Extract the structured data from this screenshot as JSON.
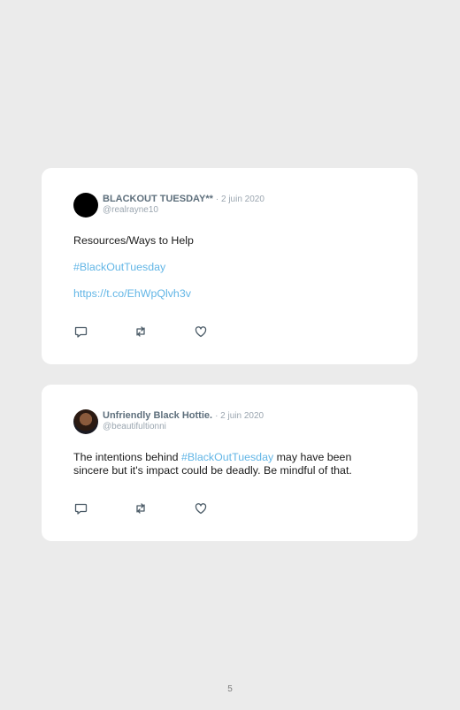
{
  "tweets": [
    {
      "display_name": "BLACKOUT TUESDAY**",
      "date": "· 2 juin 2020",
      "handle": "@realrayne10",
      "lines": [
        "Resources/Ways to Help",
        "#BlackOutTuesday",
        "https://t.co/EhWpQlvh3v"
      ],
      "avatar": "black-circle-avatar"
    },
    {
      "display_name": "Unfriendly Black Hottie.",
      "date": "· 2 juin 2020",
      "handle": "@beautifultionni",
      "text_before": "The intentions behind ",
      "hashtag": "#BlackOutTuesday",
      "text_after": " may have been sincere but it's impact could be deadly. Be mindful of that.",
      "avatar": "photo-avatar"
    }
  ],
  "icons": {
    "reply": "reply-icon",
    "retweet": "retweet-icon",
    "like": "like-icon"
  },
  "colors": {
    "background": "#ebebeb",
    "card": "#ffffff",
    "link": "#63b6e6",
    "name": "#5e6f7c",
    "meta": "#9ba6b0"
  },
  "page_number": "5"
}
